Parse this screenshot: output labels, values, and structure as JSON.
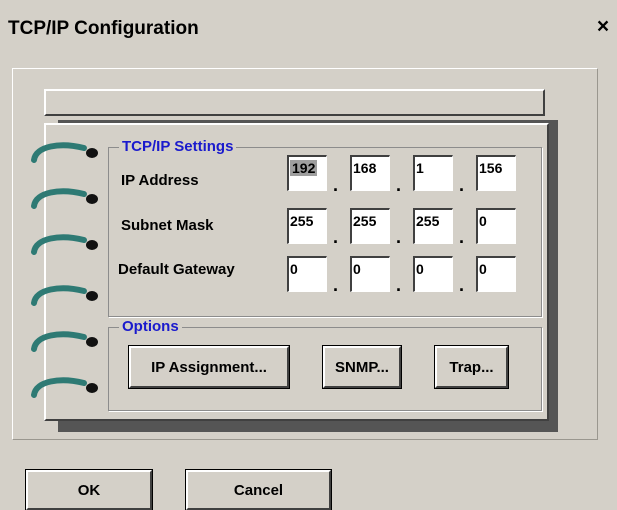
{
  "window": {
    "title": "TCP/IP Configuration",
    "close_symbol": "×"
  },
  "tcpip_settings": {
    "group_label": "TCP/IP Settings",
    "ip_address": {
      "label": "IP Address",
      "octets": [
        "192",
        "168",
        "1",
        "156"
      ]
    },
    "subnet_mask": {
      "label": "Subnet Mask",
      "octets": [
        "255",
        "255",
        "255",
        "0"
      ]
    },
    "default_gateway": {
      "label": "Default Gateway",
      "octets": [
        "0",
        "0",
        "0",
        "0"
      ]
    },
    "separator": "."
  },
  "options": {
    "group_label": "Options",
    "ip_assignment_label": "IP Assignment...",
    "snmp_label": "SNMP...",
    "trap_label": "Trap..."
  },
  "footer": {
    "ok_label": "OK",
    "cancel_label": "Cancel"
  },
  "decor": {
    "binder_ring_icon": "binder-ring-icon",
    "ring_color": "#2e7a74"
  },
  "colors": {
    "group_label": "#1a1acd",
    "background": "#d4d0c8",
    "selection": "#9e9e9e"
  }
}
